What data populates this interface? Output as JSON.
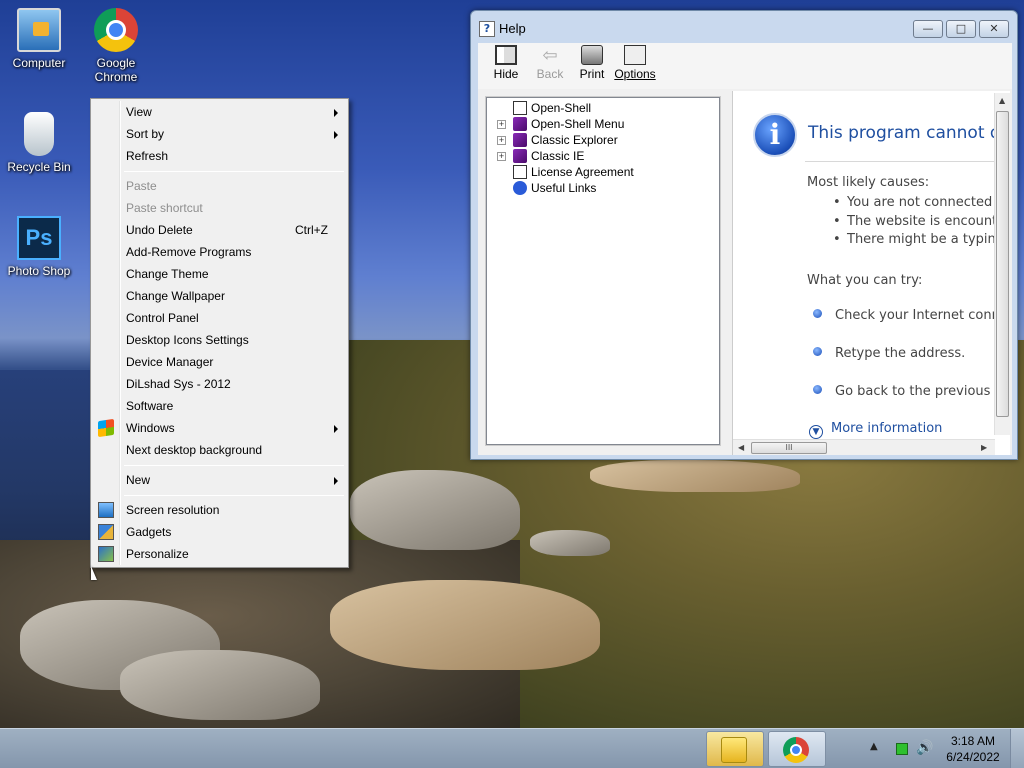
{
  "desktop": {
    "icons": [
      {
        "label": "Computer",
        "icon": "computer-icon"
      },
      {
        "label": "Google Chrome",
        "icon": "chrome-icon"
      },
      {
        "label": "Recycle Bin",
        "icon": "recycle-bin-icon"
      },
      {
        "label": "Photo Shop",
        "icon": "photoshop-icon",
        "glyph": "Ps"
      }
    ]
  },
  "context_menu": {
    "items": [
      {
        "label": "View",
        "submenu": true
      },
      {
        "label": "Sort by",
        "submenu": true
      },
      {
        "label": "Refresh"
      },
      {
        "label": "Paste",
        "disabled": true
      },
      {
        "label": "Paste shortcut",
        "disabled": true
      },
      {
        "label": "Undo Delete",
        "shortcut": "Ctrl+Z"
      },
      {
        "label": "Add-Remove Programs"
      },
      {
        "label": "Change Theme"
      },
      {
        "label": "Change Wallpaper"
      },
      {
        "label": "Control Panel"
      },
      {
        "label": "Desktop Icons Settings"
      },
      {
        "label": "Device Manager"
      },
      {
        "label": "DiLshad Sys - 2012"
      },
      {
        "label": "Software"
      },
      {
        "label": "Windows",
        "submenu": true,
        "icon": "windows-logo-icon"
      },
      {
        "label": "Next desktop background"
      },
      {
        "label": "New",
        "submenu": true
      },
      {
        "label": "Screen resolution",
        "icon": "screen-resolution-icon"
      },
      {
        "label": "Gadgets",
        "icon": "gadgets-icon"
      },
      {
        "label": "Personalize",
        "icon": "personalize-icon"
      }
    ]
  },
  "help_window": {
    "title": "Help",
    "controls": {
      "minimize": "—",
      "maximize": "□",
      "close": "✕"
    },
    "toolbar": {
      "hide": "Hide",
      "back": "Back",
      "print": "Print",
      "options": "Options"
    },
    "tree": [
      {
        "label": "Open-Shell",
        "icon": "page",
        "expandable": false
      },
      {
        "label": "Open-Shell Menu",
        "icon": "book",
        "expandable": true
      },
      {
        "label": "Classic Explorer",
        "icon": "book",
        "expandable": true
      },
      {
        "label": "Classic IE",
        "icon": "book",
        "expandable": true
      },
      {
        "label": "License Agreement",
        "icon": "page",
        "expandable": false
      },
      {
        "label": "Useful Links",
        "icon": "link",
        "expandable": false
      }
    ],
    "content": {
      "info_glyph": "i",
      "title": "This program cannot di",
      "causes_heading": "Most likely causes:",
      "causes": [
        "You are not connected t",
        "The website is encounte",
        "There might be a typing"
      ],
      "try_heading": "What you can try:",
      "tries": [
        "Check your Internet conn",
        "Retype the address.",
        "Go back to the previous p"
      ],
      "more_info": "More information",
      "hscroll_grip": "III"
    }
  },
  "taskbar": {
    "tray_up": "▲",
    "volume": "🔊",
    "time": "3:18 AM",
    "date": "6/24/2022"
  }
}
